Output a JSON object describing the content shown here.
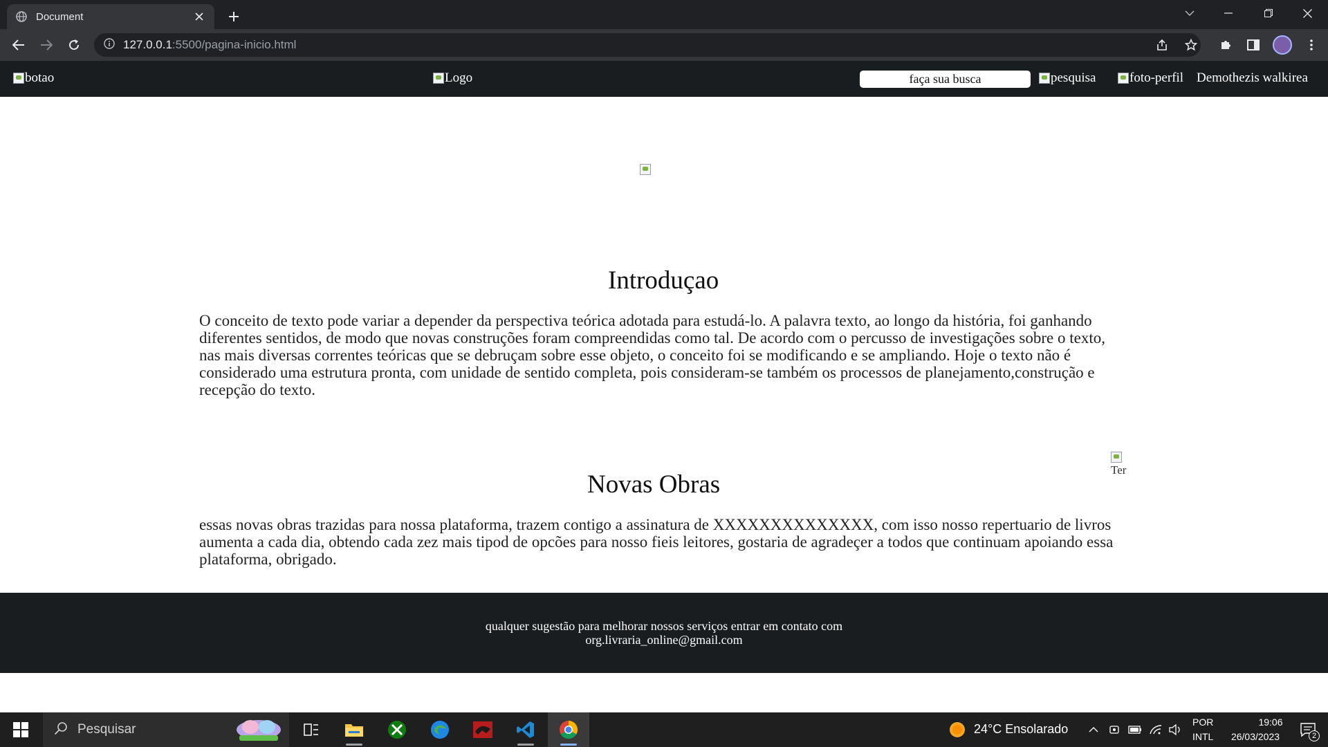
{
  "browser": {
    "tab_title": "Document",
    "url_host": "127.0.0.1",
    "url_path": ":5500/pagina-inicio.html"
  },
  "site": {
    "header": {
      "menu_alt": "botao",
      "logo_alt": "Logo",
      "search_placeholder": "faça sua busca",
      "search_button_alt": "pesquisa",
      "profile_alt": "foto-perfil",
      "user_name": "Demothezis walkirea"
    },
    "intro": {
      "title": "Introduçao",
      "text": "O conceito de texto pode variar a depender da perspectiva teórica adotada para estudá-lo. A palavra texto, ao longo da história, foi ganhando diferentes sentidos, de modo que novas construções foram compreendidas como tal. De acordo com o percusso de investigações sobre o texto, nas mais diversas correntes teóricas que se debruçam sobre esse objeto, o conceito foi se modificando e se ampliando. Hoje o texto não é considerado uma estrutura pronta, com unidade de sentido completa, pois consideram-se também os processos de planejamento,construção e recepção do texto."
    },
    "novas_obras": {
      "title": "Novas Obras",
      "side_img_alt": "Ter",
      "text": "essas novas obras trazidas para nossa plataforma, trazem contigo a assinatura de XXXXXXXXXXXXXX, com isso nosso repertuario de livros aumenta a cada dia, obtendo cada zez mais tipod de opcões para nosso fieis leitores, gostaria de agradeçer a todos que continuam apoiando essa plataforma, obrigado."
    },
    "footer": {
      "line1": "qualquer sugestão para melhorar nossos serviços entrar em contato com",
      "line2": "org.livraria_online@gmail.com"
    }
  },
  "taskbar": {
    "search_placeholder": "Pesquisar",
    "weather": "24°C  Ensolarado",
    "lang_top": "POR",
    "lang_bottom": "INTL",
    "time": "19:06",
    "date": "26/03/2023",
    "notification_count": "2"
  }
}
